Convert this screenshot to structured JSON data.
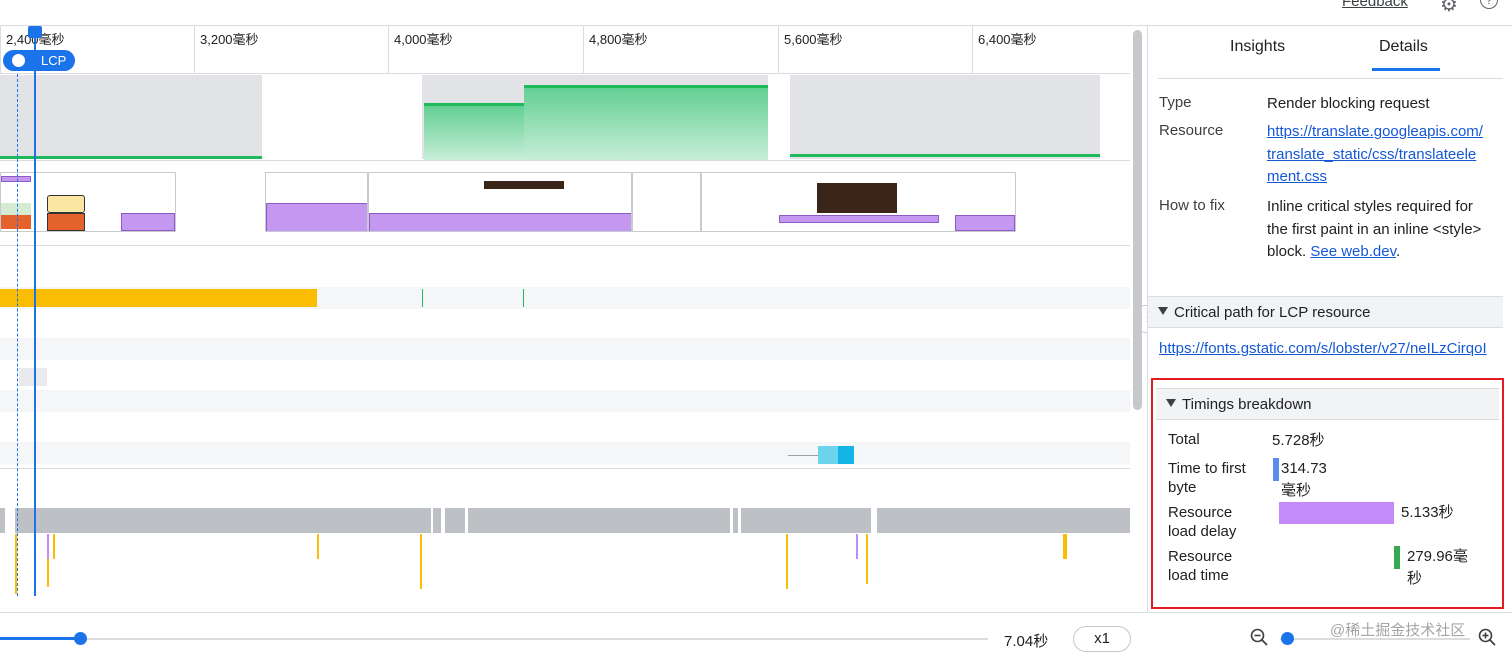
{
  "header": {
    "feedback_label": "Feedback",
    "help_glyph": "?"
  },
  "timeline": {
    "ticks": [
      "2,400毫秒",
      "3,200毫秒",
      "4,000毫秒",
      "4,800毫秒",
      "5,600毫秒",
      "6,400毫秒"
    ],
    "lcp_marker_label": "LCP"
  },
  "panel": {
    "tabs": [
      {
        "label": "Insights",
        "selected": false
      },
      {
        "label": "Details",
        "selected": true
      }
    ],
    "details": {
      "type_key": "Type",
      "type_value": "Render blocking request",
      "resource_key": "Resource",
      "resource_value": "https://translate.googleapis.com/translate_static/css/translateelement.css",
      "howtofix_key": "How to fix",
      "howtofix_text": "Inline critical styles required for the first paint in an inline <style> block.",
      "howtofix_link": "See web.dev",
      "howtofix_end": "."
    },
    "critical_path": {
      "title": "Critical path for LCP resource",
      "link": "https://fonts.gstatic.com/s/lobster/v27/neILzCirqoI"
    },
    "timings": {
      "title": "Timings breakdown",
      "rows": [
        {
          "label": "Total",
          "value": "5.728秒"
        },
        {
          "label": "Time to first byte",
          "value": "314.73毫秒"
        },
        {
          "label": "Resource load delay",
          "value": "5.133秒"
        },
        {
          "label": "Resource load time",
          "value": "279.96毫秒"
        }
      ],
      "colors": {
        "ttfb": "#5b8def",
        "delay": "#c58af9",
        "load": "#34a853"
      }
    }
  },
  "footer": {
    "duration": "7.04秒",
    "playback_speed": "x1",
    "watermark": "@稀土掘金技术社区"
  },
  "colors": {
    "accent": "#1a73e8",
    "highlight_box": "#e31c23"
  }
}
